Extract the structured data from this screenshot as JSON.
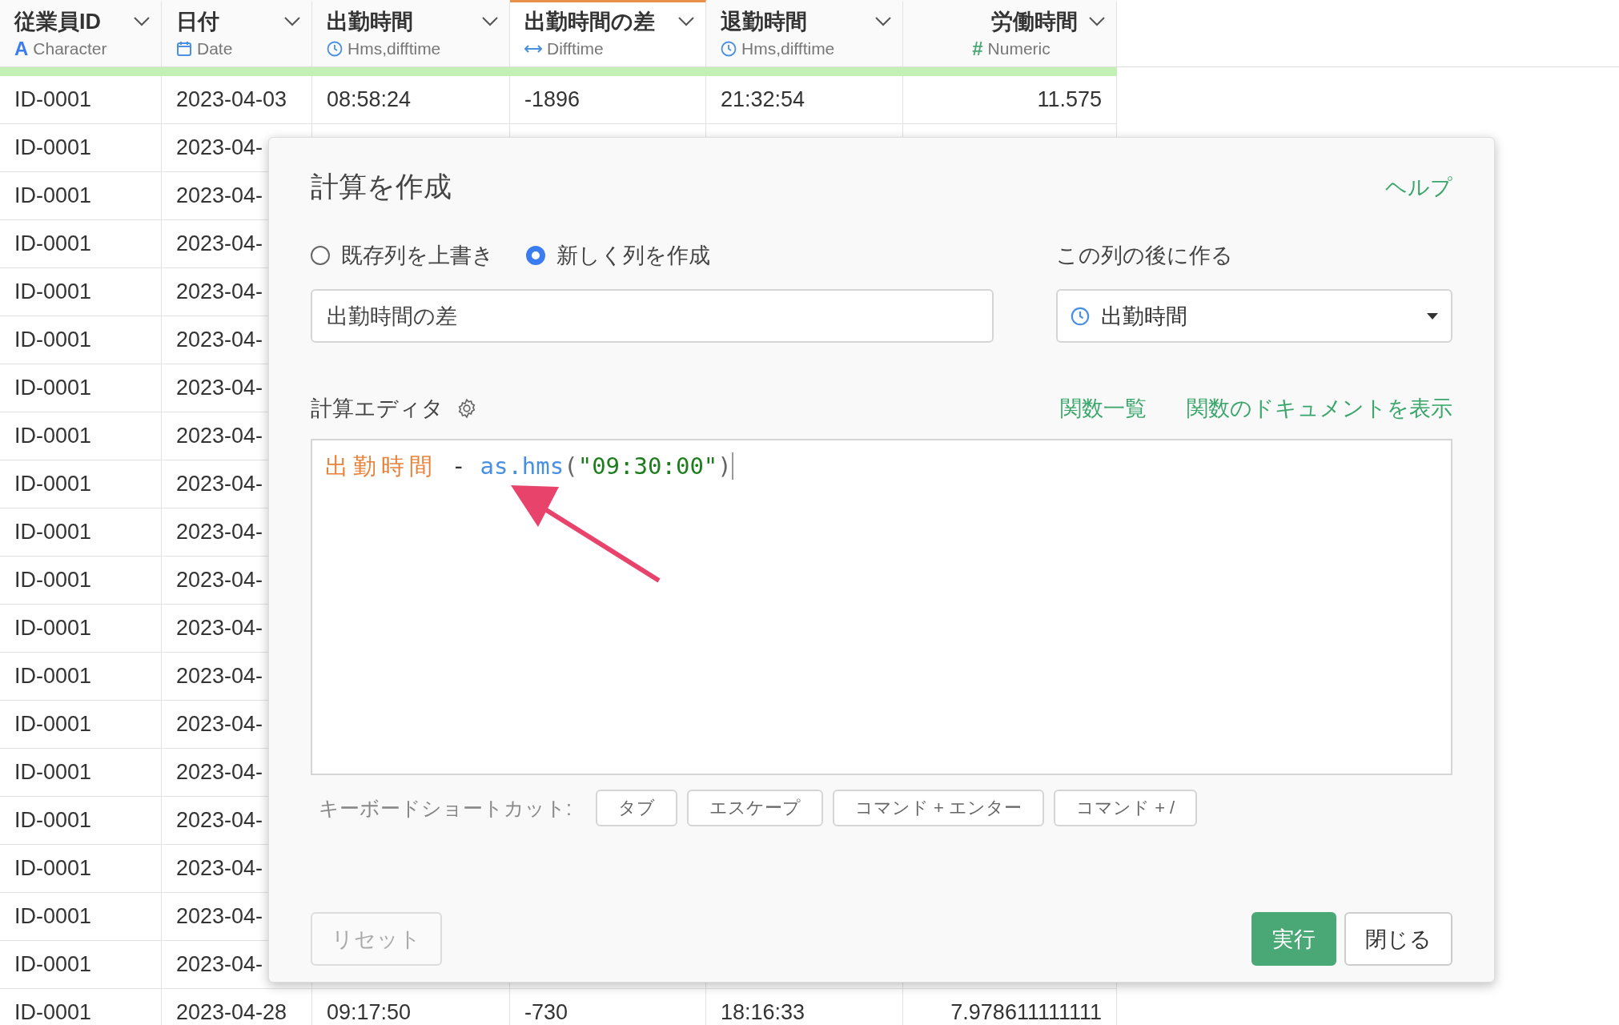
{
  "table": {
    "columns": [
      {
        "title": "従業員ID",
        "type": "Character",
        "kind": "character",
        "icon_text": "A",
        "selected": false
      },
      {
        "title": "日付",
        "type": "Date",
        "kind": "date",
        "selected": false
      },
      {
        "title": "出勤時間",
        "type": "Hms,difftime",
        "kind": "time",
        "selected": false
      },
      {
        "title": "出勤時間の差",
        "type": "Difftime",
        "kind": "difftime",
        "selected": true
      },
      {
        "title": "退勤時間",
        "type": "Hms,difftime",
        "kind": "time",
        "selected": false
      },
      {
        "title": "労働時間",
        "type": "Numeric",
        "kind": "numeric",
        "icon_text": "#",
        "selected": false
      }
    ],
    "rows": [
      {
        "cells": [
          "ID-0001",
          "2023-04-03",
          "08:58:24",
          "-1896",
          "21:32:54",
          "11.575"
        ]
      },
      {
        "cells": [
          "ID-0001",
          "2023-04-"
        ]
      },
      {
        "cells": [
          "ID-0001",
          "2023-04-"
        ]
      },
      {
        "cells": [
          "ID-0001",
          "2023-04-"
        ]
      },
      {
        "cells": [
          "ID-0001",
          "2023-04-"
        ]
      },
      {
        "cells": [
          "ID-0001",
          "2023-04-"
        ]
      },
      {
        "cells": [
          "ID-0001",
          "2023-04-"
        ]
      },
      {
        "cells": [
          "ID-0001",
          "2023-04-"
        ]
      },
      {
        "cells": [
          "ID-0001",
          "2023-04-"
        ]
      },
      {
        "cells": [
          "ID-0001",
          "2023-04-"
        ]
      },
      {
        "cells": [
          "ID-0001",
          "2023-04-"
        ]
      },
      {
        "cells": [
          "ID-0001",
          "2023-04-"
        ]
      },
      {
        "cells": [
          "ID-0001",
          "2023-04-"
        ]
      },
      {
        "cells": [
          "ID-0001",
          "2023-04-"
        ]
      },
      {
        "cells": [
          "ID-0001",
          "2023-04-"
        ]
      },
      {
        "cells": [
          "ID-0001",
          "2023-04-"
        ]
      },
      {
        "cells": [
          "ID-0001",
          "2023-04-"
        ]
      },
      {
        "cells": [
          "ID-0001",
          "2023-04-"
        ]
      },
      {
        "cells": [
          "ID-0001",
          "2023-04-"
        ]
      },
      {
        "cells": [
          "ID-0001",
          "2023-04-28",
          "09:17:50",
          "-730",
          "18:16:33",
          "7.978611111111"
        ]
      }
    ]
  },
  "dialog": {
    "title": "計算を作成",
    "help_link": "ヘルプ",
    "modes": [
      {
        "label": "既存列を上書き",
        "selected": false
      },
      {
        "label": "新しく列を作成",
        "selected": true
      }
    ],
    "name_field": {
      "value": "出勤時間の差"
    },
    "position_label": "この列の後に作る",
    "position_select": {
      "value": "出勤時間"
    },
    "editor_label": "計算エディタ",
    "editor_links": [
      "関数一覧",
      "関数のドキュメントを表示"
    ],
    "code": [
      {
        "text": "出勤時間",
        "kind": "column"
      },
      {
        "text": "-",
        "kind": "operator"
      },
      {
        "text": "as.hms",
        "kind": "function"
      },
      {
        "text": "(",
        "kind": "paren"
      },
      {
        "text": "\"09:30:00\"",
        "kind": "string"
      },
      {
        "text": ")",
        "kind": "paren"
      }
    ],
    "shortcuts_label": "キーボードショートカット:",
    "shortcuts": [
      "タブ",
      "エスケープ",
      "コマンド + エンター",
      "コマンド + /"
    ],
    "buttons": [
      {
        "label": "リセット",
        "kind": "reset"
      },
      {
        "label": "実行",
        "kind": "primary"
      },
      {
        "label": "閉じる",
        "kind": "secondary"
      }
    ]
  }
}
